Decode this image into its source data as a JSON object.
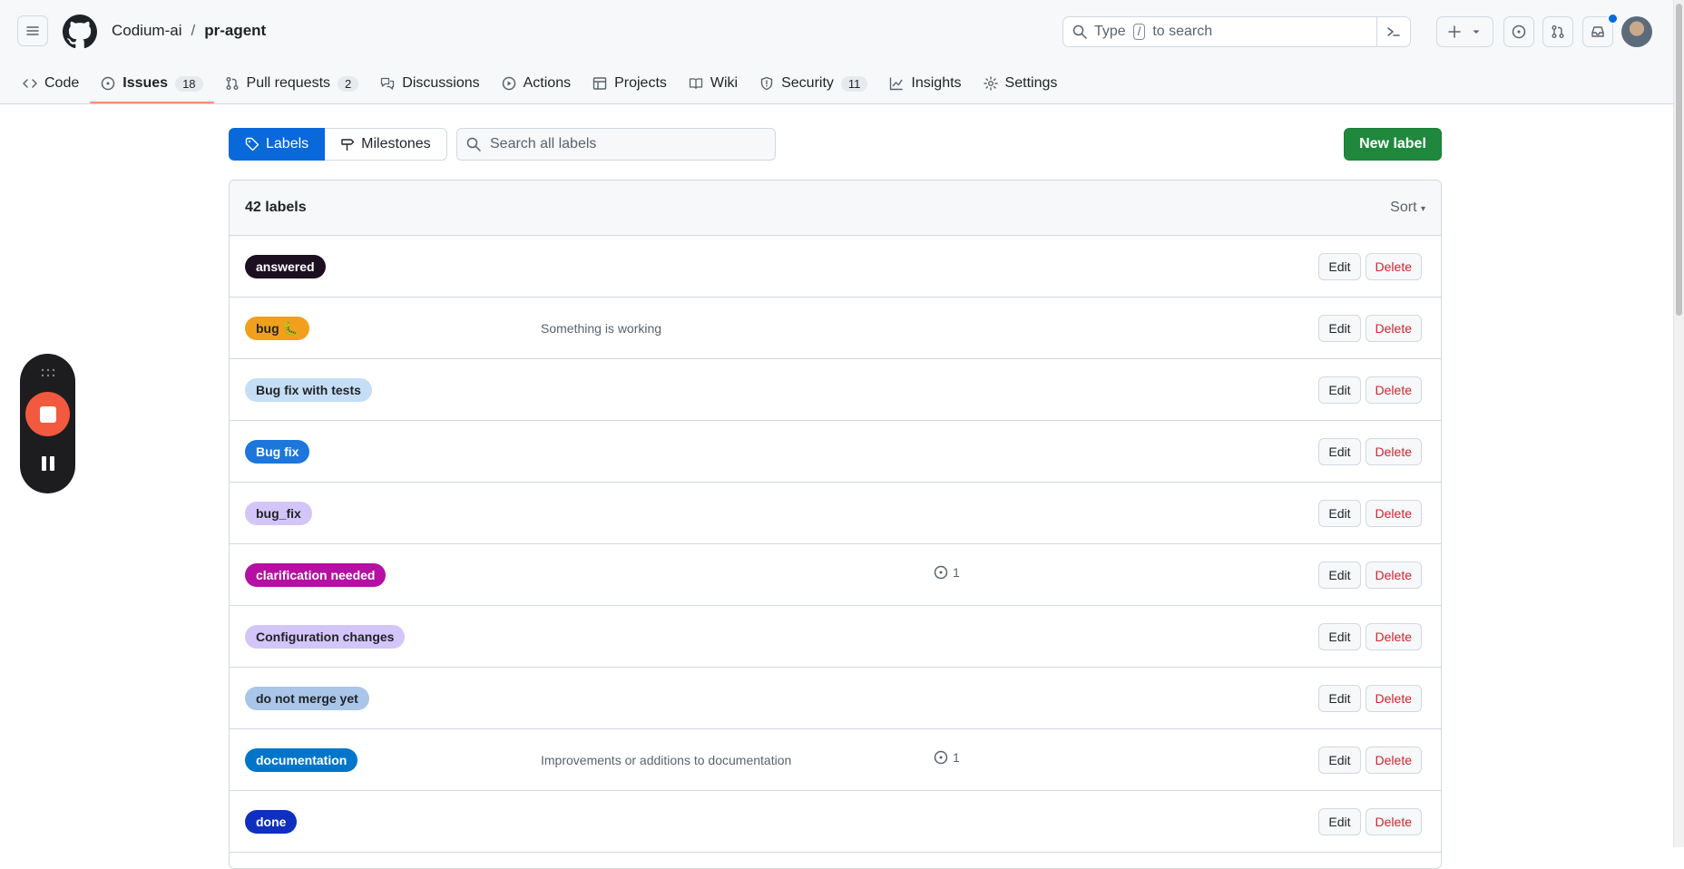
{
  "header": {
    "owner": "Codium-ai",
    "separator": "/",
    "repo": "pr-agent",
    "search_prefix": "Type",
    "search_key": "/",
    "search_suffix": "to search"
  },
  "nav": {
    "code": "Code",
    "issues": "Issues",
    "issues_count": "18",
    "pulls": "Pull requests",
    "pulls_count": "2",
    "discussions": "Discussions",
    "actions": "Actions",
    "projects": "Projects",
    "wiki": "Wiki",
    "security": "Security",
    "security_count": "11",
    "insights": "Insights",
    "settings": "Settings"
  },
  "subnav": {
    "labels": "Labels",
    "milestones": "Milestones",
    "search_placeholder": "Search all labels",
    "new_label": "New label"
  },
  "list": {
    "count_text": "42 labels",
    "sort": "Sort",
    "edit": "Edit",
    "delete": "Delete",
    "labels": [
      {
        "name": "answered",
        "bg": "#1c1020",
        "fg": "#ffffff",
        "desc": "",
        "issues": ""
      },
      {
        "name": "bug 🐛",
        "bg": "#f0a01c",
        "fg": "#1f2328",
        "desc": "Something is working",
        "issues": ""
      },
      {
        "name": "Bug fix with tests",
        "bg": "#c5def5",
        "fg": "#1f2328",
        "desc": "",
        "issues": ""
      },
      {
        "name": "Bug fix",
        "bg": "#1d76db",
        "fg": "#ffffff",
        "desc": "",
        "issues": ""
      },
      {
        "name": "bug_fix",
        "bg": "#d4c5f9",
        "fg": "#1f2328",
        "desc": "",
        "issues": ""
      },
      {
        "name": "clarification needed",
        "bg": "#b60fa3",
        "fg": "#ffffff",
        "desc": "",
        "issues": "1"
      },
      {
        "name": "Configuration changes",
        "bg": "#d4c5f9",
        "fg": "#1f2328",
        "desc": "",
        "issues": ""
      },
      {
        "name": "do not merge yet",
        "bg": "#a9c6e8",
        "fg": "#1f2328",
        "desc": "",
        "issues": ""
      },
      {
        "name": "documentation",
        "bg": "#0075ca",
        "fg": "#ffffff",
        "desc": "Improvements or additions to documentation",
        "issues": "1"
      },
      {
        "name": "done",
        "bg": "#0e2fbf",
        "fg": "#ffffff",
        "desc": "",
        "issues": ""
      }
    ]
  },
  "colors": {
    "accent": "#0969da",
    "primary_button": "#1f883d",
    "danger": "#d1242f",
    "tab_underline": "#fd8c73",
    "recorder_stop": "#f2593f"
  }
}
